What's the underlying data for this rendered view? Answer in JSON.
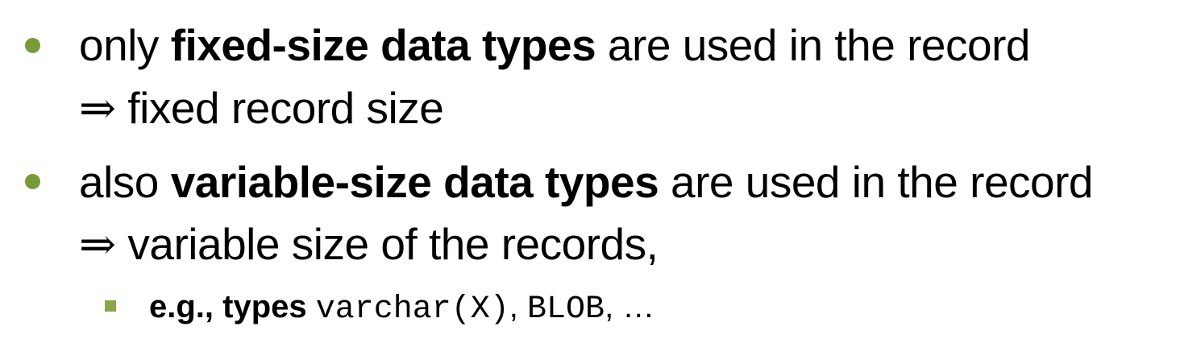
{
  "bullets": [
    {
      "pre": "only ",
      "bold": "fixed-size data types",
      "post": " are used in the record",
      "implication_arrow": "⇒",
      "implication": "fixed record size"
    },
    {
      "pre": "also ",
      "bold": "variable-size data types",
      "post": " are used in the record",
      "implication_arrow": "⇒",
      "implication": "variable size of the records,",
      "sub": {
        "bold": "e.g., types",
        "code1": "varchar(X)",
        "sep": ",",
        "code2": "BLOB",
        "tail": ", …"
      }
    }
  ],
  "colors": {
    "bullet": "#7a9a3a",
    "sub_bullet": "#8aa64a"
  }
}
